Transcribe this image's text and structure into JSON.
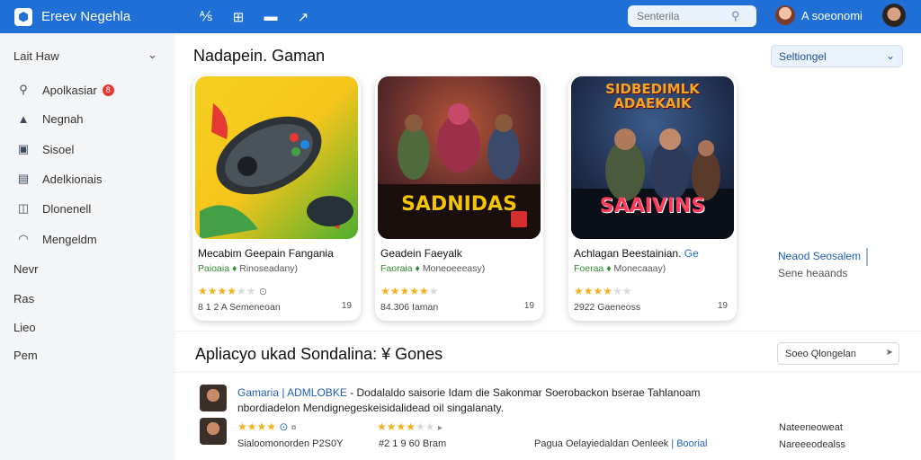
{
  "topbar": {
    "app_title": "Ereev Negehla",
    "tools": [
      "⅍",
      "⊞",
      "▬",
      "↗"
    ],
    "search_placeholder": "Senterila",
    "user_name": "A soeonomi",
    "brand_color": "#1f6fd6"
  },
  "sidebar": {
    "header": "Lait Haw",
    "items": [
      {
        "label": "Apolkasiar",
        "icon": "search-icon",
        "badge": "8"
      },
      {
        "label": "Negnah",
        "icon": "bag-icon"
      },
      {
        "label": "Sisoel",
        "icon": "square-icon"
      },
      {
        "label": "Adelkionais",
        "icon": "document-icon"
      },
      {
        "label": "Dlonenell",
        "icon": "bookmark-icon"
      },
      {
        "label": "Mengeldm",
        "icon": "cloud-icon"
      }
    ],
    "plain_items": [
      "Nevr",
      "Ras",
      "Lieo",
      "Pem"
    ]
  },
  "main": {
    "title": "Nadapein. Gaman",
    "sort_label": "Seltiongel",
    "cards": [
      {
        "name": "Mecabim Geepain Fangania",
        "publisher": "Paioaia",
        "publisher_rest": "Rinoseadany)",
        "stars": 4,
        "count": "8 1 2 A Semeneoan",
        "mini": "19"
      },
      {
        "name": "Geadein Faeyalk",
        "publisher": "Faoraia",
        "publisher_rest": "Moneoeeeasy)",
        "stars": 5,
        "count": "84.306 Iaman",
        "mini": "19",
        "art_text": "SADNIDAS"
      },
      {
        "name": "Achlagan Beestainian.",
        "name_accent": "Ge",
        "publisher": "Foeraa",
        "publisher_rest": "Monecaaay)",
        "stars": 4,
        "count": "2922 Gaeneoss",
        "mini": "19",
        "art_text_top": "SIDBEDIMLK ADAEKAIK",
        "art_text": "SAAIVINS"
      }
    ],
    "side_link": "Neaod Seosalem",
    "side_link2": "Sene heaands"
  },
  "section": {
    "title": "Apliacyo ukad Sondalina: ¥ Gones",
    "filter_label": "Soeo Qlongelan",
    "row1": {
      "link": "Gamaria | ADMLOBKE",
      "text": "- Dodalaldo saisorie Idam die Sakonmar Soerobackon bserae Tahlanoam",
      "line2": "nbordiadelon Mendignegeskeisidalidead oil singalanaty."
    },
    "row2": {
      "stars_a": "★★★★",
      "extra_a": "¤",
      "stars_b": "★★★★",
      "extra_b": "▸"
    },
    "row3": {
      "left": "Sialoomonorden P2S0Y",
      "mid": "#2 1 9 60 Bram",
      "right_text": "Pagua Oelayiedaldan Oenleek",
      "right_link": "| Boorial"
    },
    "right_meta": [
      "Nateeneoweat",
      "Nareeeodealss"
    ]
  }
}
